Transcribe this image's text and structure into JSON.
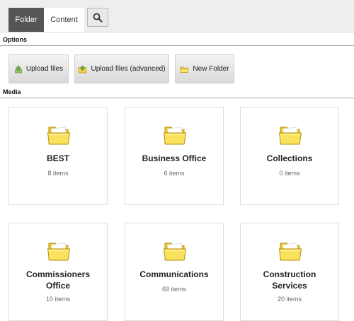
{
  "tabs": [
    {
      "label": "Folder",
      "active": true
    },
    {
      "label": "Content",
      "active": false
    }
  ],
  "search": {
    "icon": "search-icon"
  },
  "options": {
    "header": "Options",
    "buttons": [
      {
        "label": "Upload files",
        "icon": "upload-icon"
      },
      {
        "label": "Upload files (advanced)",
        "icon": "upload-advanced-icon"
      },
      {
        "label": "New Folder",
        "icon": "new-folder-icon"
      }
    ]
  },
  "media": {
    "header": "Media",
    "folders": [
      {
        "name": "BEST",
        "count": "8 items"
      },
      {
        "name": "Business Office",
        "count": "6 items"
      },
      {
        "name": "Collections",
        "count": "0 items"
      },
      {
        "name": "Commissioners Office",
        "count": "10 items"
      },
      {
        "name": "Communications",
        "count": "69 items"
      },
      {
        "name": "Construction Services",
        "count": "20 items"
      }
    ]
  },
  "colors": {
    "active_tab_bg": "#555555",
    "topbar_bg": "#eeeeee",
    "folder_yellow": "#f9d71c"
  }
}
